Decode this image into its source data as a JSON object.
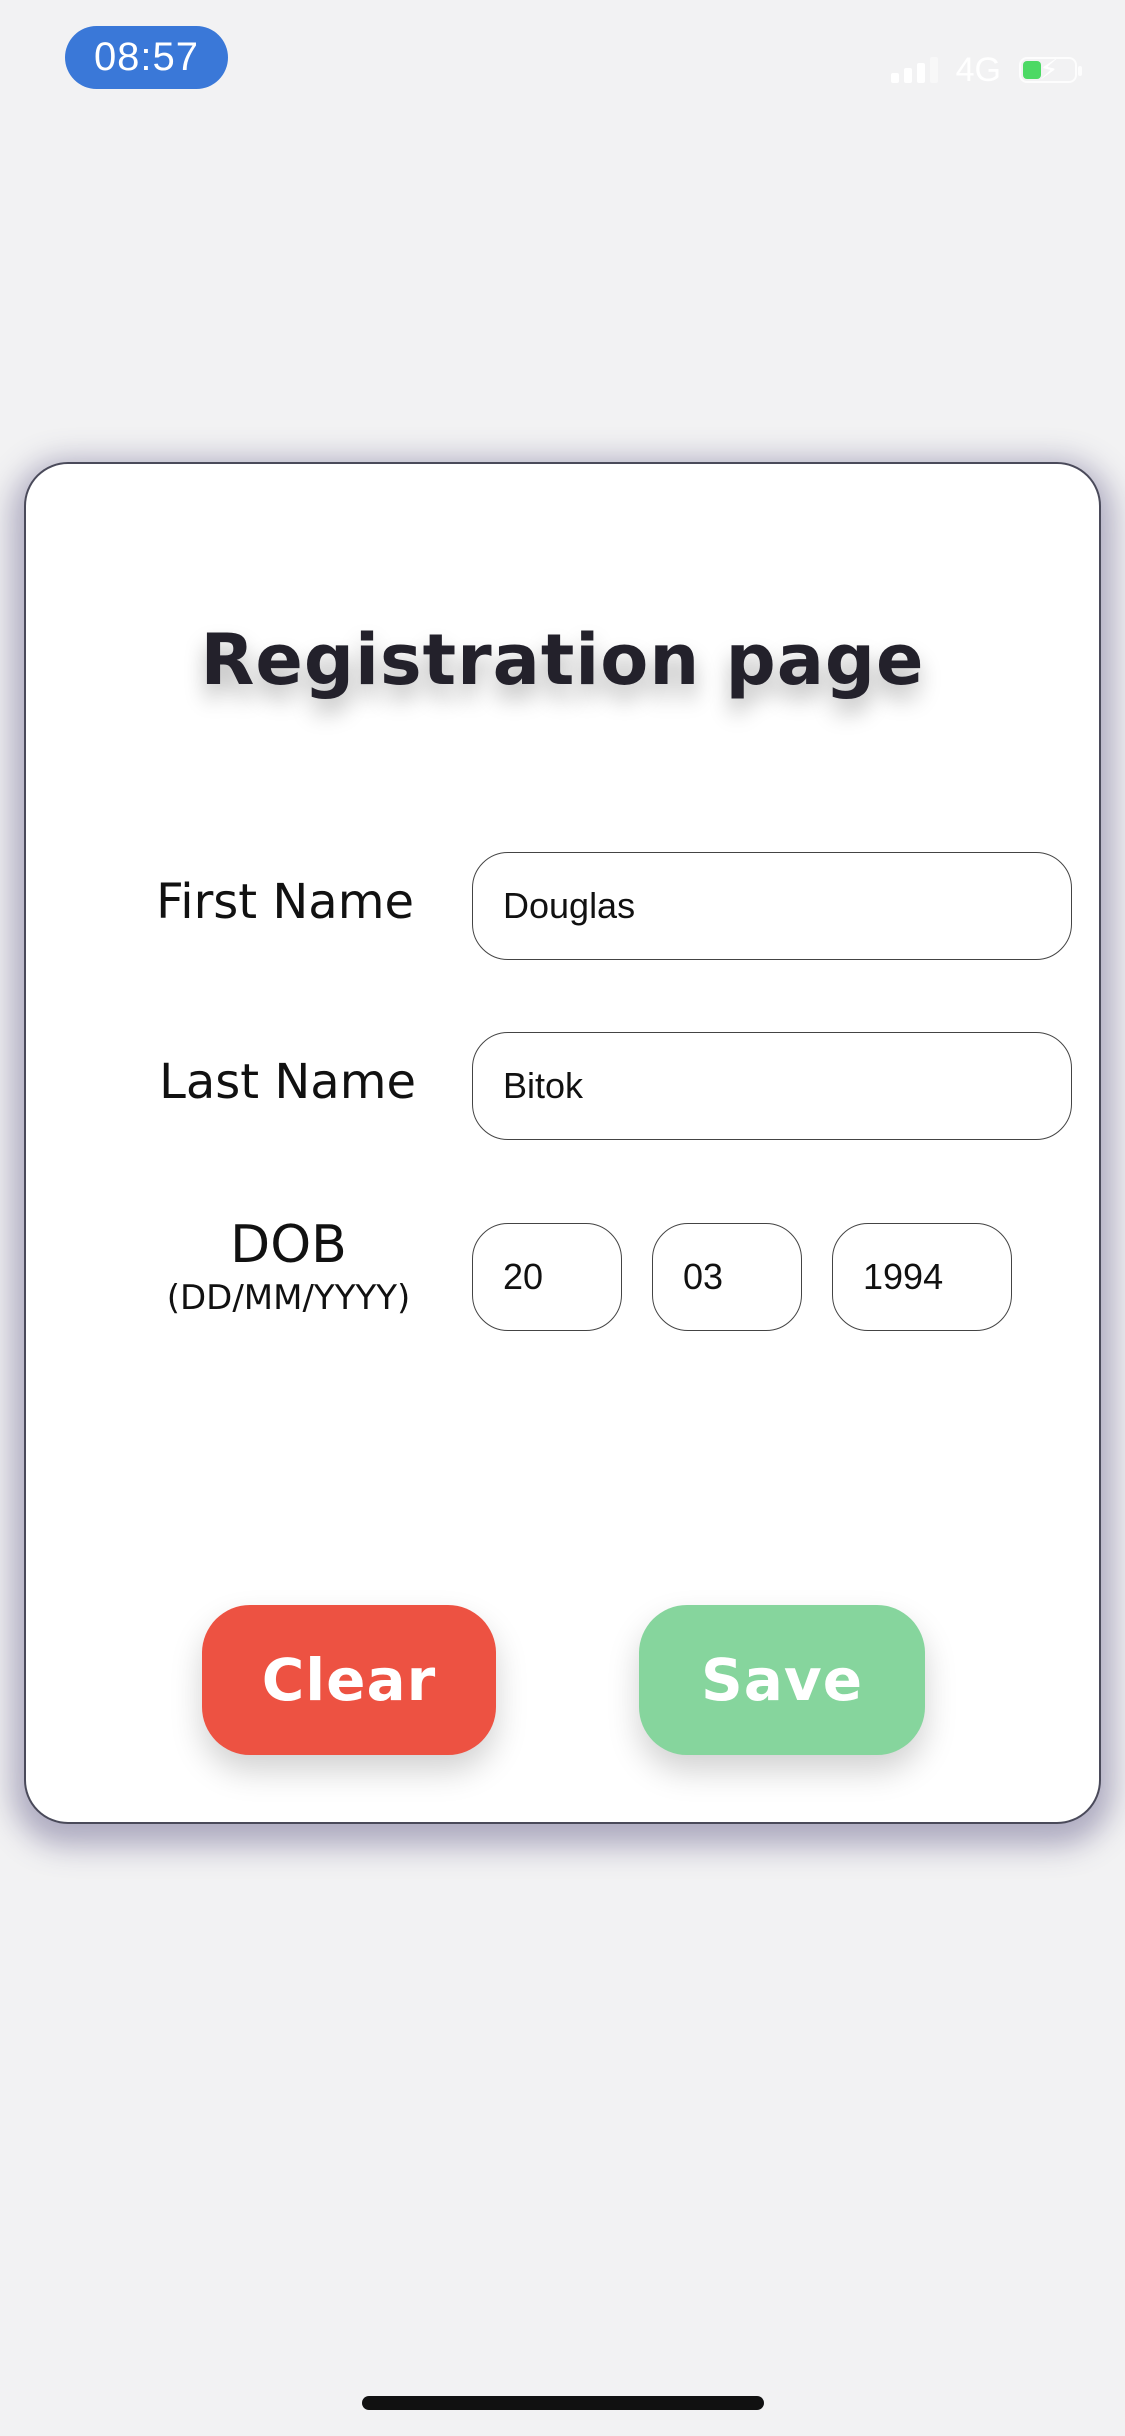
{
  "status_bar": {
    "time": "08:57",
    "network": "4G",
    "icons": [
      "signal-icon",
      "battery-charging-icon"
    ],
    "time_pill_color": "#3a78d8",
    "battery_color": "#4cd964"
  },
  "card": {
    "title": "Registration page",
    "first_name": {
      "label": "First Name",
      "value": "Douglas"
    },
    "last_name": {
      "label": "Last Name",
      "value": "Bitok"
    },
    "dob": {
      "label": "DOB",
      "format": "(DD/MM/YYYY)",
      "day": "20",
      "month": "03",
      "year": "1994"
    }
  },
  "actions": {
    "clear_label": "Clear",
    "save_label": "Save",
    "clear_color": "#ed5242",
    "save_color": "#86d59d"
  }
}
